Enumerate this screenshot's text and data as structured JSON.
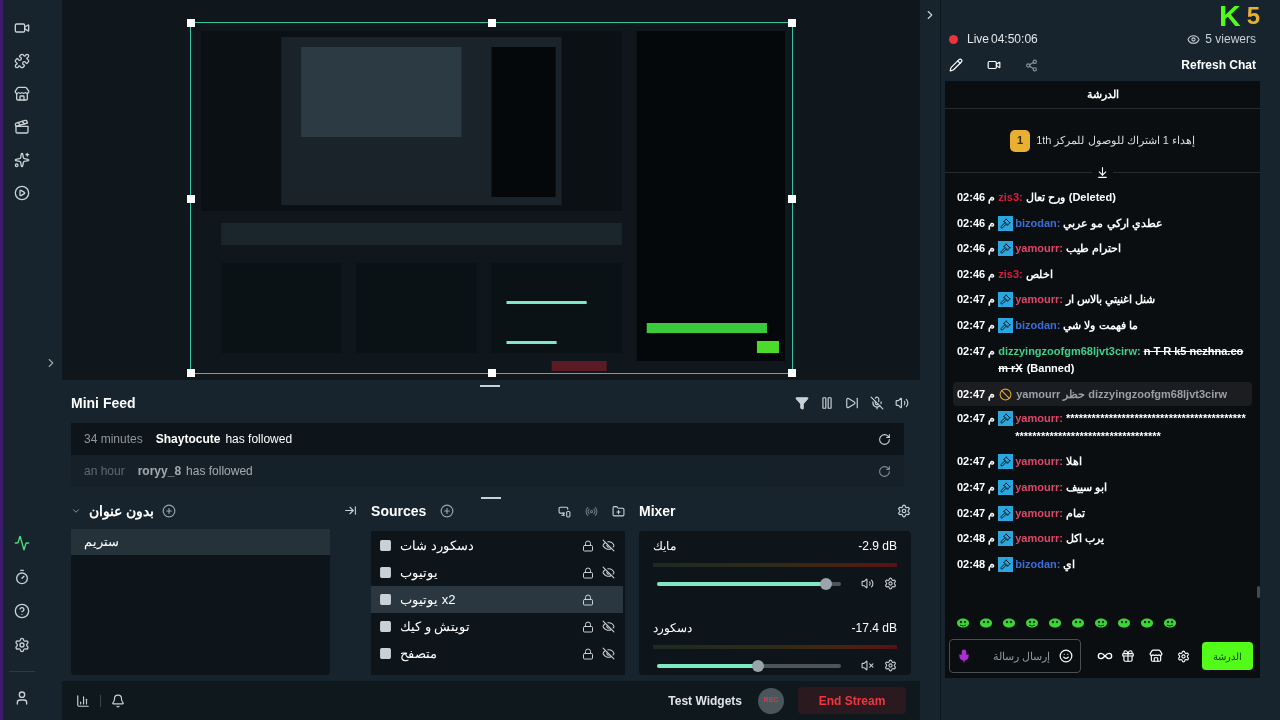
{
  "mini_feed": {
    "title": "Mini Feed",
    "events": [
      {
        "time": "34 minutes",
        "user": "Shaytocute",
        "action": "has followed",
        "faded": false
      },
      {
        "time": "an hour",
        "user": "roryy_8",
        "action": "has followed",
        "faded": true
      }
    ]
  },
  "scenes": {
    "title": "بدون عنوان",
    "items": [
      {
        "name": "ستريم",
        "selected": true
      }
    ]
  },
  "sources": {
    "title": "Sources",
    "items": [
      {
        "name": "دسكورد شات",
        "selected": false,
        "hidden": true
      },
      {
        "name": "يوتيوب",
        "selected": false,
        "hidden": true
      },
      {
        "name": "يوتيوب x2",
        "selected": true,
        "hidden": false
      },
      {
        "name": "تويتش و كيك",
        "selected": false,
        "hidden": true
      },
      {
        "name": "متصفح",
        "selected": false,
        "hidden": true
      }
    ]
  },
  "mixer": {
    "title": "Mixer",
    "channels": [
      {
        "name": "مايك",
        "reading": "-2.9 dB",
        "level": 0.92,
        "muted": false
      },
      {
        "name": "دسكورد",
        "reading": "-17.4 dB",
        "level": 0.55,
        "muted": true
      }
    ]
  },
  "bottom_bar": {
    "test_widgets": "Test Widgets",
    "rec": "REC",
    "end_stream": "End Stream"
  },
  "chat": {
    "logo": {
      "letter": "K",
      "digit": "5"
    },
    "live": "Live",
    "timer": "04:50:06",
    "viewers": "5 viewers",
    "refresh": "Refresh Chat",
    "title": "الدرشة",
    "pinned": {
      "rank": "1",
      "text": "إهداء 1 اشتراك للوصول للمركز 1th"
    },
    "messages": [
      {
        "kind": "message",
        "time": "02:46 م",
        "moderator": false,
        "user": "zis3:",
        "color": "#e3173e",
        "text": "ورح تعال",
        "struck": false,
        "note": "(Deleted)"
      },
      {
        "kind": "message",
        "time": "02:46 م",
        "moderator": true,
        "user": "bizodan:",
        "color": "#3b6fd6",
        "text": "عطدي اركي مو عربي",
        "struck": false
      },
      {
        "kind": "message",
        "time": "02:46 م",
        "moderator": true,
        "user": "yamourr:",
        "color": "#e0456a",
        "text": "احترام طيب",
        "struck": false
      },
      {
        "kind": "message",
        "time": "02:46 م",
        "moderator": false,
        "user": "zis3:",
        "color": "#e3173e",
        "text": "اخلص",
        "struck": false
      },
      {
        "kind": "message",
        "time": "02:47 م",
        "moderator": true,
        "user": "yamourr:",
        "color": "#e0456a",
        "text": "شنل اغنيتي بالاس ار",
        "struck": false
      },
      {
        "kind": "message",
        "time": "02:47 م",
        "moderator": true,
        "user": "bizodan:",
        "color": "#3b6fd6",
        "text": "ما فهمت ولا شي",
        "struck": false
      },
      {
        "kind": "message",
        "time": "02:47 م",
        "moderator": false,
        "user": "dizzyingzoofgm68ljvt3cirw:",
        "color": "#3fcf8e",
        "text": "n T R k5 nezhna.com rX",
        "struck": true,
        "note": "(Banned)"
      },
      {
        "kind": "ban",
        "time": "02:47 م",
        "text": "yamourr حظر dizzyingzoofgm68ljvt3cirw"
      },
      {
        "kind": "message",
        "time": "02:47 م",
        "moderator": true,
        "user": "yamourr:",
        "color": "#e0456a",
        "text": "****************************************************************************",
        "struck": false
      },
      {
        "kind": "message",
        "time": "02:47 م",
        "moderator": true,
        "user": "yamourr:",
        "color": "#e0456a",
        "text": "اهلا",
        "struck": false
      },
      {
        "kind": "message",
        "time": "02:47 م",
        "moderator": true,
        "user": "yamourr:",
        "color": "#e0456a",
        "text": "ابو سييف",
        "struck": false
      },
      {
        "kind": "message",
        "time": "02:47 م",
        "moderator": true,
        "user": "yamourr:",
        "color": "#e0456a",
        "text": "تمام",
        "struck": false
      },
      {
        "kind": "message",
        "time": "02:48 م",
        "moderator": true,
        "user": "yamourr:",
        "color": "#e0456a",
        "text": "يرب اكل",
        "struck": false
      },
      {
        "kind": "message",
        "time": "02:48 م",
        "moderator": true,
        "user": "bizodan:",
        "color": "#3b6fd6",
        "text": "اي",
        "struck": false
      }
    ],
    "input": {
      "placeholder": "إرسال رسالة"
    },
    "send": "الدرشة"
  }
}
